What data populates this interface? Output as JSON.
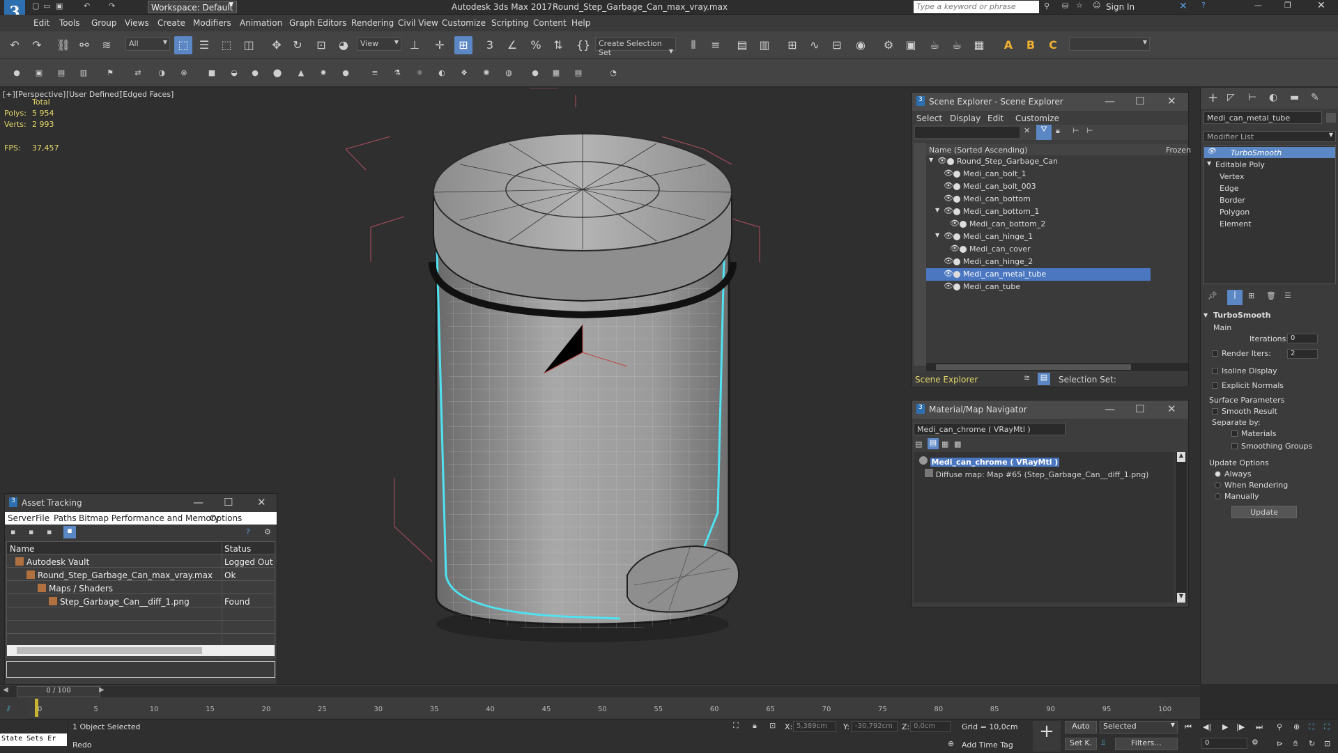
{
  "window": {
    "workspace_label": "Workspace: Default",
    "title": "Autodesk 3ds Max 2017",
    "file": "Round_Step_Garbage_Can_max_vray.max",
    "search_placeholder": "Type a keyword or phrase",
    "sign_in": "Sign In"
  },
  "menu": [
    "Edit",
    "Tools",
    "Group",
    "Views",
    "Create",
    "Modifiers",
    "Animation",
    "Graph Editors",
    "Rendering",
    "Civil View",
    "Customize",
    "Scripting",
    "Content",
    "Help"
  ],
  "toolbar": {
    "filter_value": "All",
    "view_value": "View",
    "selection_set": "Create Selection Set"
  },
  "viewport": {
    "label_plus": "[+]",
    "label_view": "[Perspective]",
    "label_shading": "[User Defined]",
    "label_edges": "[Edged Faces]",
    "stats_total": "Total",
    "polys_label": "Polys:",
    "polys_value": "5 954",
    "verts_label": "Verts:",
    "verts_value": "2 993",
    "fps_label": "FPS:",
    "fps_value": "37,457"
  },
  "scene_explorer": {
    "title": "Scene Explorer - Scene Explorer",
    "menu": [
      "Select",
      "Display",
      "Edit",
      "Customize"
    ],
    "col_name": "Name (Sorted Ascending)",
    "col_frozen": "Frozen",
    "items": [
      {
        "name": "Round_Step_Garbage_Can",
        "indent": 0,
        "expanded": true,
        "selected": false
      },
      {
        "name": "Medi_can_bolt_1",
        "indent": 1,
        "selected": false
      },
      {
        "name": "Medi_can_bolt_003",
        "indent": 1,
        "selected": false
      },
      {
        "name": "Medi_can_bottom",
        "indent": 1,
        "selected": false
      },
      {
        "name": "Medi_can_bottom_1",
        "indent": 1,
        "expanded": true,
        "selected": false
      },
      {
        "name": "Medi_can_bottom_2",
        "indent": 2,
        "selected": false
      },
      {
        "name": "Medi_can_hinge_1",
        "indent": 1,
        "expanded": true,
        "selected": false
      },
      {
        "name": "Medi_can_cover",
        "indent": 2,
        "selected": false
      },
      {
        "name": "Medi_can_hinge_2",
        "indent": 1,
        "selected": false
      },
      {
        "name": "Medi_can_metal_tube",
        "indent": 1,
        "selected": true
      },
      {
        "name": "Medi_can_tube",
        "indent": 1,
        "selected": false
      }
    ],
    "footer_label": "Scene Explorer",
    "selection_set_label": "Selection Set:"
  },
  "material_nav": {
    "title": "Material/Map Navigator",
    "current": "Medi_can_chrome  ( VRayMtl )",
    "root": "Medi_can_chrome  ( VRayMtl )",
    "child": "Diffuse map: Map #65 (Step_Garbage_Can__diff_1.png)"
  },
  "asset_tracking": {
    "title": "Asset Tracking",
    "menu": [
      "Server",
      "File",
      "Paths",
      "Bitmap Performance and Memory",
      "Options"
    ],
    "col_name": "Name",
    "col_status": "Status",
    "rows": [
      {
        "name": "Autodesk Vault",
        "status": "Logged Out (",
        "indent": 0
      },
      {
        "name": "Round_Step_Garbage_Can_max_vray.max",
        "status": "Ok",
        "indent": 1
      },
      {
        "name": "Maps / Shaders",
        "status": "",
        "indent": 2
      },
      {
        "name": "Step_Garbage_Can__diff_1.png",
        "status": "Found",
        "indent": 3
      }
    ]
  },
  "command_panel": {
    "object_name": "Medi_can_metal_tube",
    "modifier_list": "Modifier List",
    "stack": [
      {
        "name": "TurboSmooth",
        "active": true
      },
      {
        "name": "Editable Poly",
        "active": false
      },
      {
        "name": "Vertex",
        "active": false,
        "sub": true
      },
      {
        "name": "Edge",
        "active": false,
        "sub": true
      },
      {
        "name": "Border",
        "active": false,
        "sub": true
      },
      {
        "name": "Polygon",
        "active": false,
        "sub": true
      },
      {
        "name": "Element",
        "active": false,
        "sub": true
      }
    ],
    "rollout_title": "TurboSmooth",
    "main_label": "Main",
    "iterations_label": "Iterations:",
    "iterations_value": "0",
    "render_iters_label": "Render Iters:",
    "render_iters_value": "2",
    "isoline_label": "Isoline Display",
    "explicit_normals_label": "Explicit Normals",
    "surface_params_label": "Surface Parameters",
    "smooth_result_label": "Smooth Result",
    "separate_by_label": "Separate by:",
    "materials_label": "Materials",
    "smoothing_groups_label": "Smoothing Groups",
    "update_options_label": "Update Options",
    "always_label": "Always",
    "when_rendering_label": "When Rendering",
    "manually_label": "Manually",
    "update_button": "Update"
  },
  "timeline": {
    "frame": "0 / 100",
    "ticks": [
      "0",
      "5",
      "10",
      "15",
      "20",
      "25",
      "30",
      "35",
      "40",
      "45",
      "50",
      "55",
      "60",
      "65",
      "70",
      "75",
      "80",
      "85",
      "90",
      "95",
      "100"
    ]
  },
  "status": {
    "state_sets": "State Sets Er",
    "selected": "1 Object Selected",
    "prompt": "Redo",
    "x_label": "X:",
    "x_value": "5,389cm",
    "y_label": "Y:",
    "y_value": "-30,792cm",
    "z_label": "Z:",
    "z_value": "0,0cm",
    "grid": "Grid = 10,0cm",
    "add_time_tag": "Add Time Tag",
    "auto": "Auto",
    "selected_dd": "Selected",
    "setk": "Set K.",
    "filters": "Filters...",
    "frame_value": "0"
  }
}
